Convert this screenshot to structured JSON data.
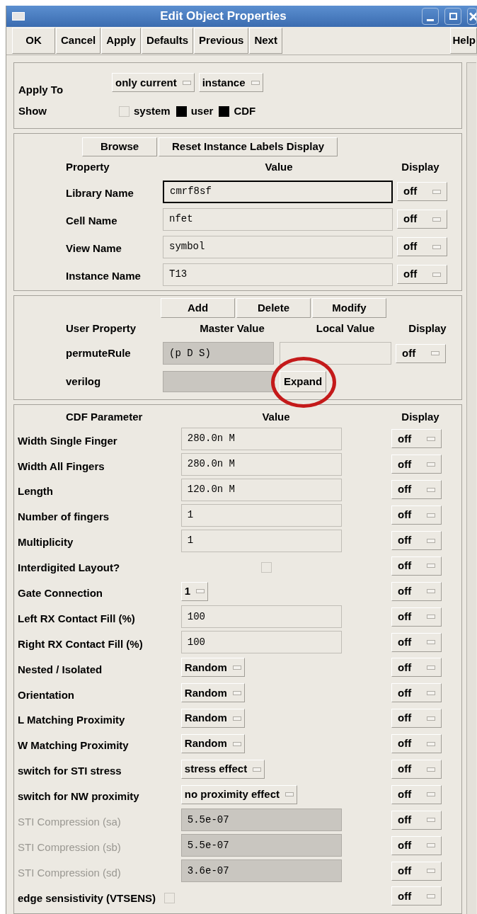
{
  "window": {
    "title": "Edit Object Properties"
  },
  "toolbar": [
    "OK",
    "Cancel",
    "Apply",
    "Defaults",
    "Previous",
    "Next"
  ],
  "help_button": "Help",
  "apply_section": {
    "apply_to_label": "Apply To",
    "apply_to": [
      "only current",
      "instance"
    ],
    "show_label": "Show",
    "show": [
      {
        "label": "system",
        "checked": false
      },
      {
        "label": "user",
        "checked": true
      },
      {
        "label": "CDF",
        "checked": true
      }
    ]
  },
  "instance_section": {
    "buttons": [
      "Browse",
      "Reset Instance Labels Display"
    ],
    "columns": [
      "Property",
      "Value",
      "Display"
    ],
    "rows": [
      {
        "name": "Library Name",
        "value": "cmrf8sf",
        "focused": true,
        "display": "off"
      },
      {
        "name": "Cell Name",
        "value": "nfet",
        "focused": false,
        "display": "off"
      },
      {
        "name": "View Name",
        "value": "symbol",
        "focused": false,
        "display": "off"
      },
      {
        "name": "Instance Name",
        "value": "T13",
        "focused": false,
        "display": "off"
      }
    ]
  },
  "user_section": {
    "buttons": [
      "Add",
      "Delete",
      "Modify"
    ],
    "columns": [
      "User Property",
      "Master Value",
      "Local Value",
      "Display"
    ],
    "rows": [
      {
        "name": "permuteRule",
        "master": "(p D S)",
        "kind": "local",
        "display": "off"
      },
      {
        "name": "verilog",
        "master": "",
        "kind": "expand",
        "button": "Expand",
        "highlighted": true
      }
    ]
  },
  "cdf_section": {
    "columns": [
      "CDF Parameter",
      "Value",
      "Display"
    ],
    "rows": [
      {
        "name": "Width Single Finger",
        "kind": "field",
        "value": "280.0n M",
        "disabled": false,
        "display": "off"
      },
      {
        "name": "Width All Fingers",
        "kind": "field",
        "value": "280.0n M",
        "disabled": false,
        "display": "off"
      },
      {
        "name": "Length",
        "kind": "field",
        "value": "120.0n M",
        "disabled": false,
        "display": "off"
      },
      {
        "name": "Number of fingers",
        "kind": "field",
        "value": "1",
        "disabled": false,
        "display": "off"
      },
      {
        "name": "Multiplicity",
        "kind": "field",
        "value": "1",
        "disabled": false,
        "display": "off"
      },
      {
        "name": "Interdigited Layout?",
        "kind": "checkbox",
        "checked": false,
        "disabled": false,
        "display": "off"
      },
      {
        "name": "Gate Connection",
        "kind": "cycle",
        "value": "1",
        "disabled": false,
        "display": "off"
      },
      {
        "name": "Left RX Contact Fill (%)",
        "kind": "field",
        "value": "100",
        "disabled": false,
        "display": "off"
      },
      {
        "name": "Right RX Contact Fill (%)",
        "kind": "field",
        "value": "100",
        "disabled": false,
        "display": "off"
      },
      {
        "name": "Nested / Isolated",
        "kind": "cycle",
        "value": "Random",
        "disabled": false,
        "display": "off"
      },
      {
        "name": "Orientation",
        "kind": "cycle",
        "value": "Random",
        "disabled": false,
        "display": "off"
      },
      {
        "name": "L Matching Proximity",
        "kind": "cycle",
        "value": "Random",
        "disabled": false,
        "display": "off"
      },
      {
        "name": "W Matching Proximity",
        "kind": "cycle",
        "value": "Random",
        "disabled": false,
        "display": "off"
      },
      {
        "name": "switch for STI stress",
        "kind": "cycle",
        "value": "stress effect",
        "disabled": false,
        "display": "off"
      },
      {
        "name": "switch for NW proximity",
        "kind": "cycle",
        "value": "no proximity effect",
        "disabled": false,
        "display": "off"
      },
      {
        "name": "STI Compression (sa)",
        "kind": "field",
        "value": "5.5e-07",
        "disabled": true,
        "display": "off"
      },
      {
        "name": "STI Compression (sb)",
        "kind": "field",
        "value": "5.5e-07",
        "disabled": true,
        "display": "off"
      },
      {
        "name": "STI Compression (sd)",
        "kind": "field",
        "value": "3.6e-07",
        "disabled": true,
        "display": "off"
      },
      {
        "name": "edge sensistivity (VTSENS)",
        "kind": "checkbox",
        "checked": false,
        "disabled": false,
        "display": "off"
      }
    ]
  }
}
